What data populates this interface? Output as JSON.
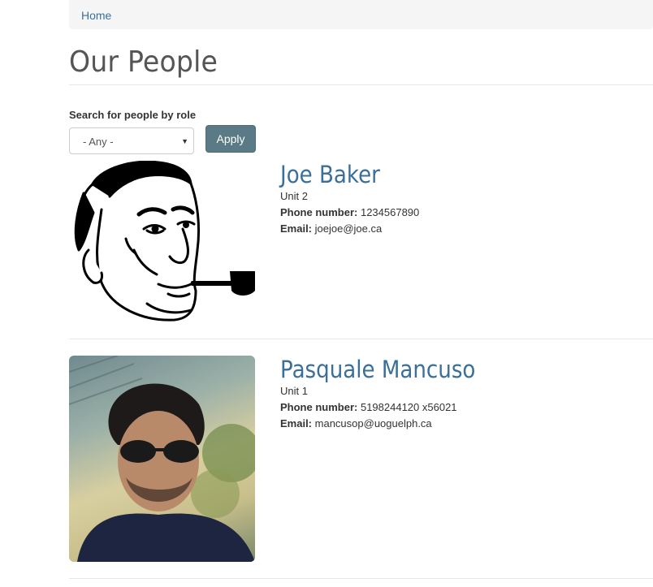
{
  "breadcrumb": {
    "home": "Home"
  },
  "page": {
    "title": "Our People"
  },
  "filter": {
    "label": "Search for people by role",
    "selected": "- Any -",
    "apply_label": "Apply"
  },
  "people": [
    {
      "name": "Joe Baker",
      "unit": "Unit 2",
      "phone_label": "Phone number:",
      "phone": "1234567890",
      "email_label": "Email:",
      "email": "joejoe@joe.ca"
    },
    {
      "name": "Pasquale Mancuso",
      "unit": "Unit 1",
      "phone_label": "Phone number:",
      "phone": "5198244120 x56021",
      "email_label": "Email:",
      "email": "mancusop@uoguelph.ca"
    }
  ],
  "colors": {
    "link": "#3a6f99",
    "button": "#5a7a85",
    "breadcrumb_bg": "#f5f5f5"
  }
}
